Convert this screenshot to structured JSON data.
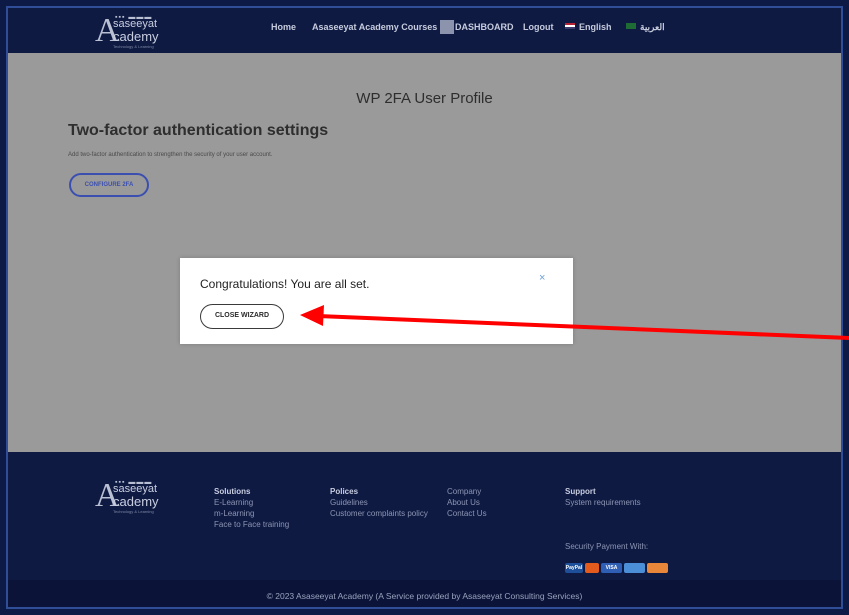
{
  "header": {
    "logo": {
      "line1": "saseeyat",
      "line2": "cademy",
      "tagline": "Technology & Learning",
      "letter": "A"
    },
    "nav": {
      "home": "Home",
      "courses": "Asaseeyat Academy Courses",
      "dashboard": "DASHBOARD",
      "logout": "Logout",
      "english": "English",
      "arabic": "العربية"
    }
  },
  "main": {
    "page_title": "WP 2FA User Profile",
    "section_title": "Two-factor authentication settings",
    "section_desc": "Add two-factor authentication to strengthen the security of your user account.",
    "configure_button": "CONFIGURE 2FA"
  },
  "modal": {
    "title": "Congratulations! You are all set.",
    "close_icon": "×",
    "close_wizard": "CLOSE WIZARD"
  },
  "annotation": {
    "arrow_color": "#ff0000"
  },
  "footer": {
    "solutions": {
      "heading": "Solutions",
      "items": [
        "E-Learning",
        "m-Learning",
        "Face to Face training"
      ]
    },
    "polices": {
      "heading": "Polices",
      "items": [
        "Guidelines",
        "Customer complaints policy"
      ]
    },
    "company": {
      "heading": "Company",
      "items": [
        "About Us",
        "Contact Us"
      ]
    },
    "support": {
      "heading": "Support",
      "items": [
        "System requirements"
      ]
    },
    "payment_label": "Security Payment With:",
    "payment_methods": [
      "PayPal",
      "MasterCard",
      "VISA",
      "Amex",
      "Discover"
    ],
    "copyright": "© 2023 Asaseeyat Academy (A Service provided by Asaseeyat Consulting Services)"
  },
  "colors": {
    "navy": "#0f1a43",
    "overlay": "#9a9a9a",
    "accent_blue": "#3b4fb1"
  }
}
